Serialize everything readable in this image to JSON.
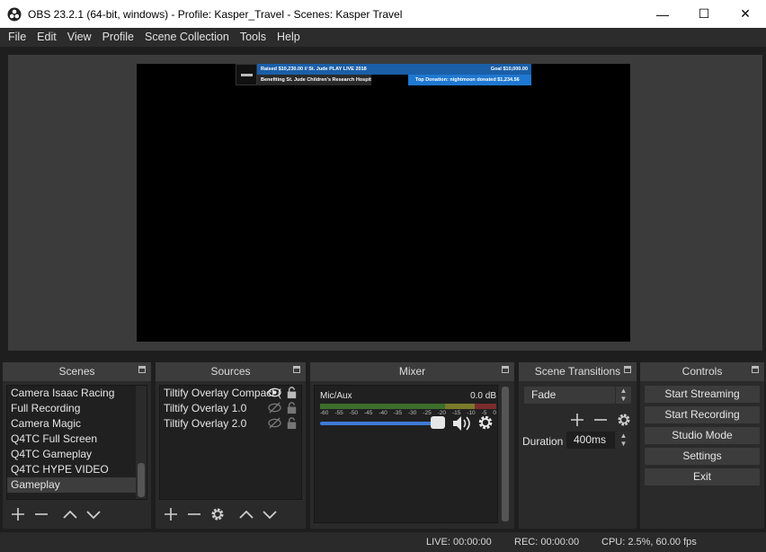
{
  "window": {
    "title": "OBS 23.2.1 (64-bit, windows) - Profile: Kasper_Travel - Scenes: Kasper Travel",
    "minimize": "—",
    "maximize": "☐",
    "close": "✕"
  },
  "menu": [
    "File",
    "Edit",
    "View",
    "Profile",
    "Scene Collection",
    "Tools",
    "Help"
  ],
  "preview": {
    "overlay": {
      "raised": "Raised $10,230.00 // St. Jude PLAY LIVE 2018",
      "goal": "Goal $10,000.00",
      "benefiting": "Benefiting St. Jude Children's Research Hospital",
      "top_donation": "Top Donation: nightmoon donated $1,234.56"
    }
  },
  "docks": {
    "scenes": {
      "title": "Scenes",
      "items": [
        "Camera Isaac Racing",
        "Full Recording",
        "Camera Magic",
        "Q4TC Full Screen",
        "Q4TC Gameplay",
        "Q4TC HYPE VIDEO",
        "Gameplay"
      ],
      "selected": "Gameplay"
    },
    "sources": {
      "title": "Sources",
      "items": [
        "Tiltify Overlay Compact (",
        "Tiltify Overlay 1.0",
        "Tiltify Overlay 2.0"
      ]
    },
    "mixer": {
      "title": "Mixer",
      "channel": "Mic/Aux",
      "db": "0.0 dB",
      "ticks": [
        "-60",
        "-55",
        "-50",
        "-45",
        "-40",
        "-35",
        "-30",
        "-25",
        "-20",
        "-15",
        "-10",
        "-5",
        "0"
      ],
      "volume_level": 0.9
    },
    "transitions": {
      "title": "Scene Transitions",
      "selected": "Fade",
      "duration_label": "Duration",
      "duration_value": "400ms"
    },
    "controls": {
      "title": "Controls",
      "buttons": [
        "Start Streaming",
        "Start Recording",
        "Studio Mode",
        "Settings",
        "Exit"
      ]
    }
  },
  "status": {
    "live": "LIVE: 00:00:00",
    "rec": "REC: 00:00:00",
    "cpu": "CPU: 2.5%, 60.00 fps"
  },
  "colors": {
    "accent": "#3f7ad6",
    "background": "#2a2a2a"
  }
}
